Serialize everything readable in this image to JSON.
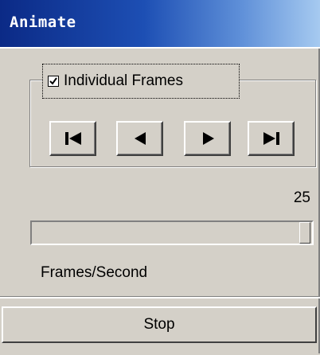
{
  "window": {
    "title": "Animate"
  },
  "group": {
    "checkbox_label": "Individual Frames",
    "checkbox_checked": true
  },
  "transport": {
    "buttons": [
      {
        "name": "first-frame-button",
        "icon": "skip-to-start-icon"
      },
      {
        "name": "step-back-button",
        "icon": "step-back-icon"
      },
      {
        "name": "step-forward-button",
        "icon": "step-forward-icon"
      },
      {
        "name": "last-frame-button",
        "icon": "skip-to-end-icon"
      }
    ]
  },
  "rate": {
    "value": "25",
    "slider_fraction": 1.0,
    "label": "Frames/Second"
  },
  "actions": {
    "stop_label": "Stop"
  }
}
